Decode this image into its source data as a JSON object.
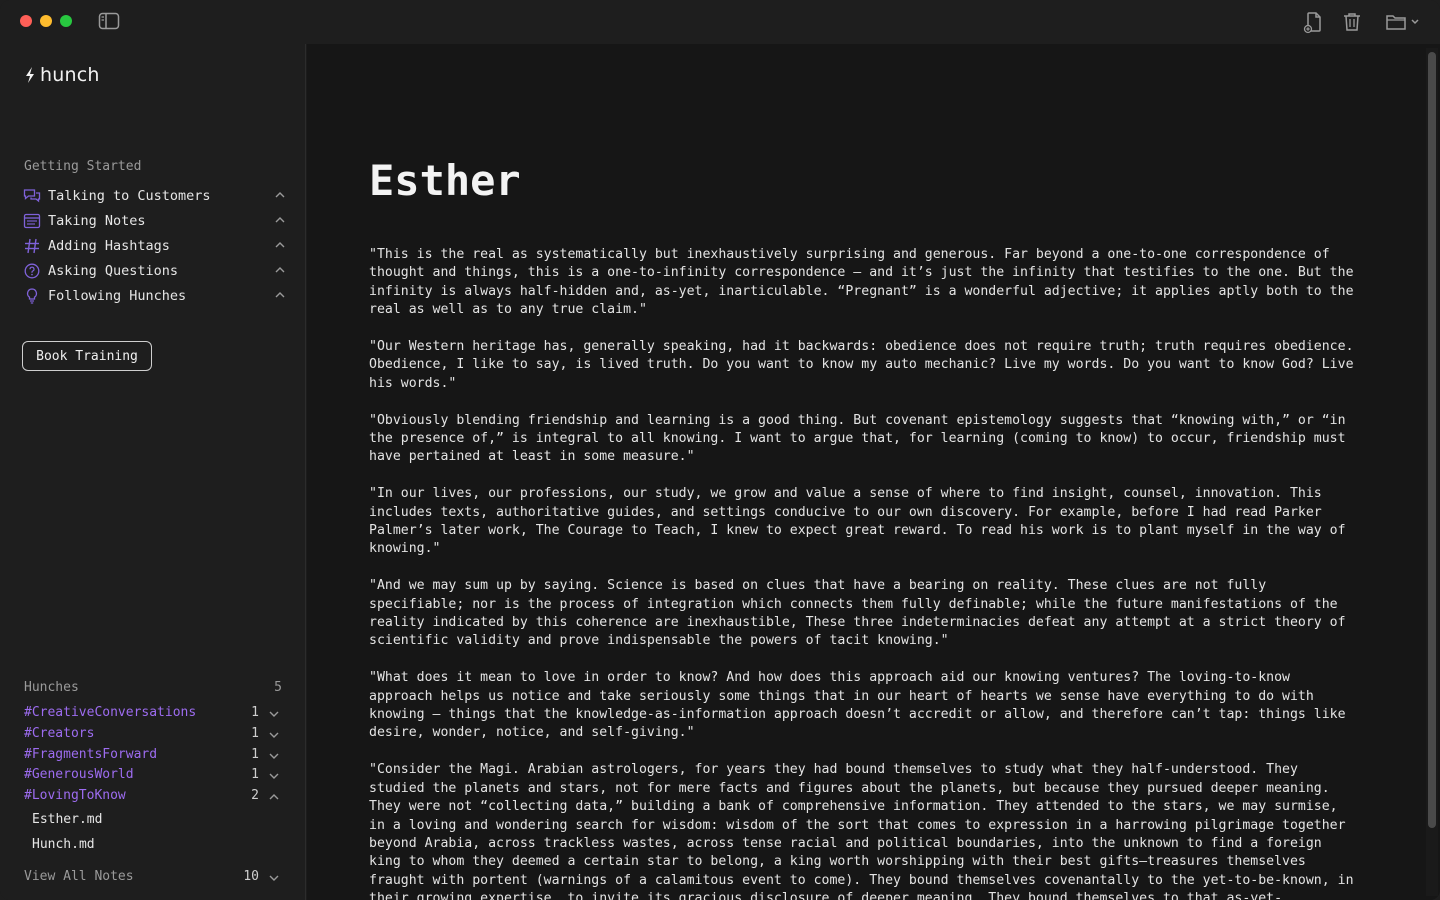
{
  "app": {
    "name": "hunch"
  },
  "sidebar": {
    "getting_started_label": "Getting Started",
    "getting_started_items": [
      {
        "label": "Talking to Customers",
        "icon": "chat-bubbles-icon"
      },
      {
        "label": "Taking Notes",
        "icon": "notepad-icon"
      },
      {
        "label": "Adding Hashtags",
        "icon": "hashtag-icon"
      },
      {
        "label": "Asking Questions",
        "icon": "question-circle-icon"
      },
      {
        "label": "Following Hunches",
        "icon": "lightbulb-icon"
      }
    ],
    "book_training_label": "Book Training",
    "hunches_label": "Hunches",
    "hunches_count": "5",
    "tags": [
      {
        "tag": "#CreativeConversations",
        "count": "1",
        "expanded": false
      },
      {
        "tag": "#Creators",
        "count": "1",
        "expanded": false
      },
      {
        "tag": "#FragmentsForward",
        "count": "1",
        "expanded": false
      },
      {
        "tag": "#GenerousWorld",
        "count": "1",
        "expanded": false
      },
      {
        "tag": "#LovingToKnow",
        "count": "2",
        "expanded": true
      }
    ],
    "files": [
      "Esther.md",
      "Hunch.md"
    ],
    "view_all_label": "View All Notes",
    "view_all_count": "10"
  },
  "note": {
    "title": "Esther",
    "paragraphs": [
      "\"This is the real as systematically but inexhaustively surprising and generous. Far beyond a one-to-one correspondence of thought and things, this is a one-to-infinity correspondence – and it’s just the infinity that testifies to the one. But the infinity is always half-hidden and, as-yet, inarticulable. “Pregnant” is a wonderful adjective; it applies aptly both to the real as well as to any true claim.\"",
      "\"Our Western heritage has, generally speaking, had it backwards: obedience does not require truth; truth requires obedience. Obedience, I like to say, is lived truth. Do you want to know my auto mechanic? Live my words. Do you want to know God? Live his words.\"",
      "\"Obviously blending friendship and learning is a good thing. But covenant epistemology suggests that “knowing with,” or “in the presence of,” is integral to all knowing. I want to argue that, for learning (coming to know) to occur, friendship must have pertained at least in some measure.\"",
      "\"In our lives, our professions, our study, we grow and value a sense of where to find insight, counsel, innovation. This includes texts, authoritative guides, and settings conducive to our own discovery. For example, before I had read Parker Palmer’s later work, The Courage to Teach, I knew to expect great reward. To read his work is to plant myself in the way of knowing.\"",
      "\"And we may sum up by saying. Science is based on clues that have a bearing on reality. These clues are not fully specifiable; nor is the process of integration which connects them fully definable; while the future manifestations of the reality indicated by this coherence are inexhaustible, These three indeterminacies defeat any attempt at a strict theory of scientific validity and prove indispensable the powers of tacit knowing.\"",
      "\"What does it mean to love in order to know? And how does this approach aid our knowing ventures? The loving-to-know approach helps us notice and take seriously some things that in our heart of hearts we sense have everything to do with knowing – things that the knowledge-as-information approach doesn’t accredit or allow, and therefore can’t tap: things like desire, wonder, notice, and self-giving.\"",
      "\"Consider the Magi. Arabian astrologers, for years they had bound themselves to study what they half-understood. They studied the planets and stars, not for mere facts and figures about the planets, but because they pursued deeper meaning. They were not “collecting data,” building a bank of comprehensive information. They attended to the stars, we may surmise, in a loving and wondering search for wisdom: wisdom of the sort that comes to expression in a harrowing pilgrimage together beyond Arabia, across trackless wastes, across tense racial and political boundaries, into the unknown to find a foreign king to whom they deemed a certain star to belong, a king worth worshipping with their best gifts—treasures themselves fraught with portent (warnings of a calamitous event to come). They bound themselves covenantally to the yet-to-be-known, in their growing expertise, to invite its gracious disclosure of deeper meaning. They bound themselves to that as-yet-"
    ]
  },
  "toolbar": {
    "new_note_icon": "new-note-icon",
    "trash_icon": "trash-icon",
    "folder_icon": "folder-icon"
  },
  "colors": {
    "tag": "#9d6cf0",
    "accent_icon": "#7f62d9"
  }
}
